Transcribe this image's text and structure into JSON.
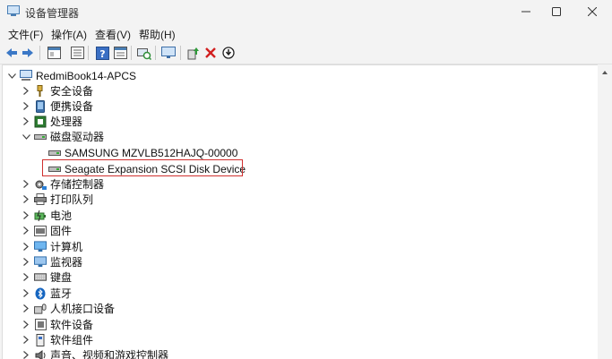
{
  "window": {
    "title": "设备管理器",
    "accent_color": "#d0302f"
  },
  "menu": [
    {
      "label": "文件(F)"
    },
    {
      "label": "操作(A)"
    },
    {
      "label": "查看(V)"
    },
    {
      "label": "帮助(H)"
    }
  ],
  "toolbar_icons": [
    "back-icon",
    "forward-icon",
    "properties-icon",
    "tree-icon",
    "help-icon",
    "details-icon",
    "scan-hardware-icon",
    "monitor-icon",
    "update-driver-icon",
    "uninstall-icon",
    "download-icon"
  ],
  "tree": {
    "root": "RedmiBook14-APCS",
    "items": [
      {
        "label": "安全设备",
        "icon": "security-device-icon",
        "expanded": false
      },
      {
        "label": "便携设备",
        "icon": "portable-device-icon",
        "expanded": false
      },
      {
        "label": "处理器",
        "icon": "processor-icon",
        "expanded": false
      },
      {
        "label": "磁盘驱动器",
        "icon": "disk-drive-icon",
        "expanded": true,
        "children": [
          {
            "label": "SAMSUNG MZVLB512HAJQ-00000",
            "icon": "disk-icon"
          },
          {
            "label": "Seagate Expansion SCSI Disk Device",
            "icon": "disk-icon",
            "highlighted": true
          }
        ]
      },
      {
        "label": "存储控制器",
        "icon": "storage-controller-icon",
        "expanded": false
      },
      {
        "label": "打印队列",
        "icon": "printer-icon",
        "expanded": false
      },
      {
        "label": "电池",
        "icon": "battery-icon",
        "expanded": false
      },
      {
        "label": "固件",
        "icon": "firmware-icon",
        "expanded": false
      },
      {
        "label": "计算机",
        "icon": "computer-icon",
        "expanded": false
      },
      {
        "label": "监视器",
        "icon": "monitor-icon",
        "expanded": false
      },
      {
        "label": "键盘",
        "icon": "keyboard-icon",
        "expanded": false
      },
      {
        "label": "蓝牙",
        "icon": "bluetooth-icon",
        "expanded": false
      },
      {
        "label": "人机接口设备",
        "icon": "hid-icon",
        "expanded": false
      },
      {
        "label": "软件设备",
        "icon": "software-device-icon",
        "expanded": false
      },
      {
        "label": "软件组件",
        "icon": "software-component-icon",
        "expanded": false
      },
      {
        "label": "声音、视频和游戏控制器",
        "icon": "sound-icon",
        "expanded": false
      }
    ]
  }
}
